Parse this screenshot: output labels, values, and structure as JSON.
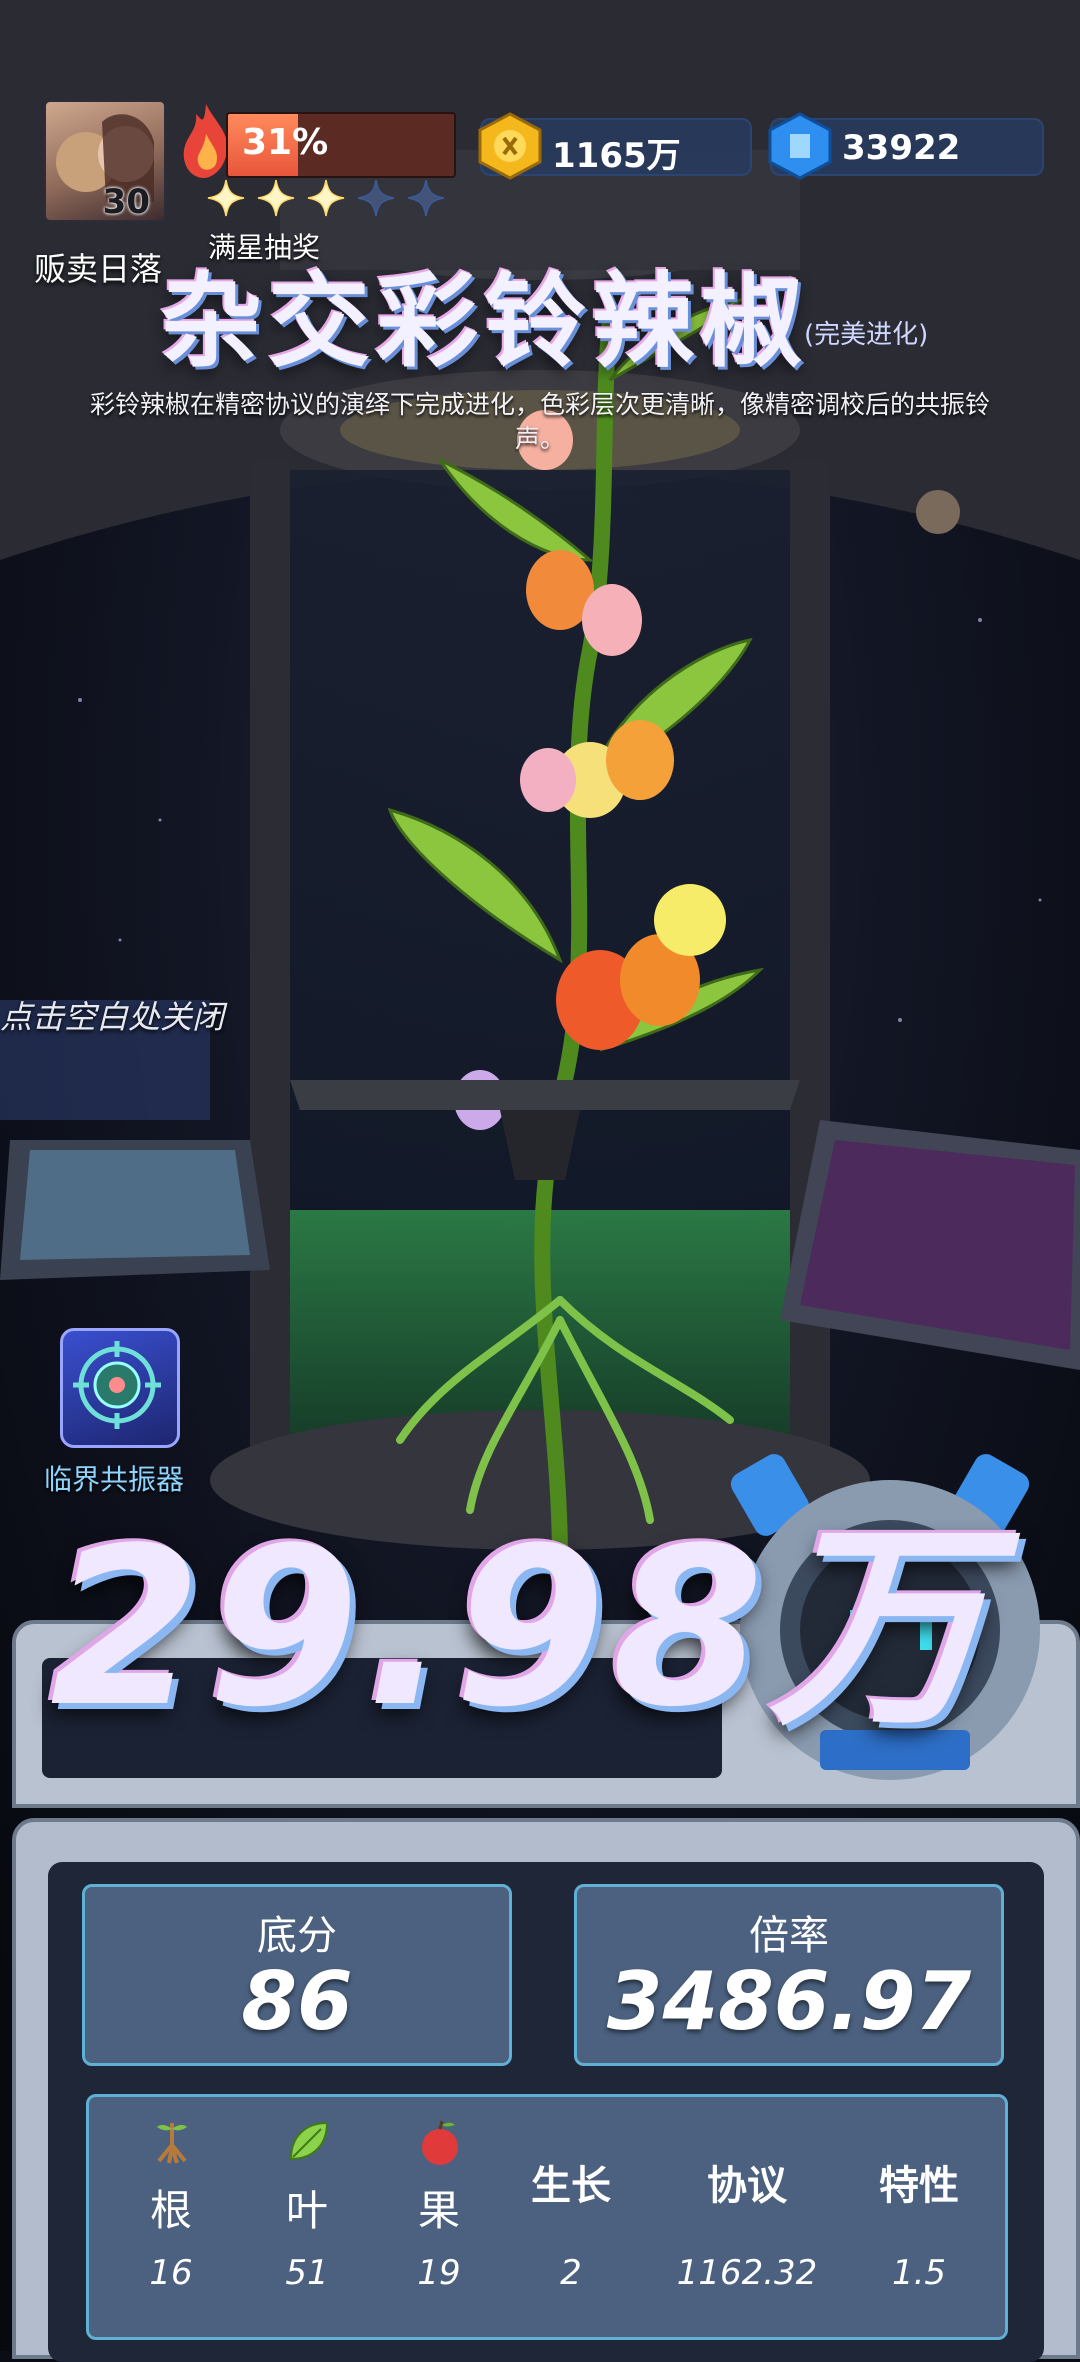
{
  "player": {
    "name": "贩卖日落",
    "level": "30"
  },
  "progress": {
    "percent_label": "31%",
    "fraction": 0.31
  },
  "stars": {
    "filled": 3,
    "total": 5,
    "label": "满星抽奖"
  },
  "currencies": {
    "gold": "1165万",
    "gem": "33922"
  },
  "plant": {
    "title": "杂交彩铃辣椒",
    "suffix": "(完美进化)",
    "description": "彩铃辣椒在精密协议的演绎下完成进化，色彩层次更清晰，像精密调校后的共振铃声。"
  },
  "hint": {
    "close": "点击空白处关闭"
  },
  "skill": {
    "label": "临界共振器",
    "icon": "target-core-icon"
  },
  "result": {
    "total": "29.98万"
  },
  "stats": {
    "base_label": "底分",
    "base_value": "86",
    "multiplier_label": "倍率",
    "multiplier_value": "3486.97"
  },
  "attributes": [
    {
      "label": "根",
      "value": "16",
      "icon": "root-icon"
    },
    {
      "label": "叶",
      "value": "51",
      "icon": "leaf-icon"
    },
    {
      "label": "果",
      "value": "19",
      "icon": "fruit-icon"
    },
    {
      "label": "生长",
      "value": "2"
    },
    {
      "label": "协议",
      "value": "1162.32"
    },
    {
      "label": "特性",
      "value": "1.5"
    }
  ],
  "colors": {
    "progress": "#e8563b",
    "panel_accent": "#5fb0d4",
    "title_glow": "#8ab6f2"
  }
}
